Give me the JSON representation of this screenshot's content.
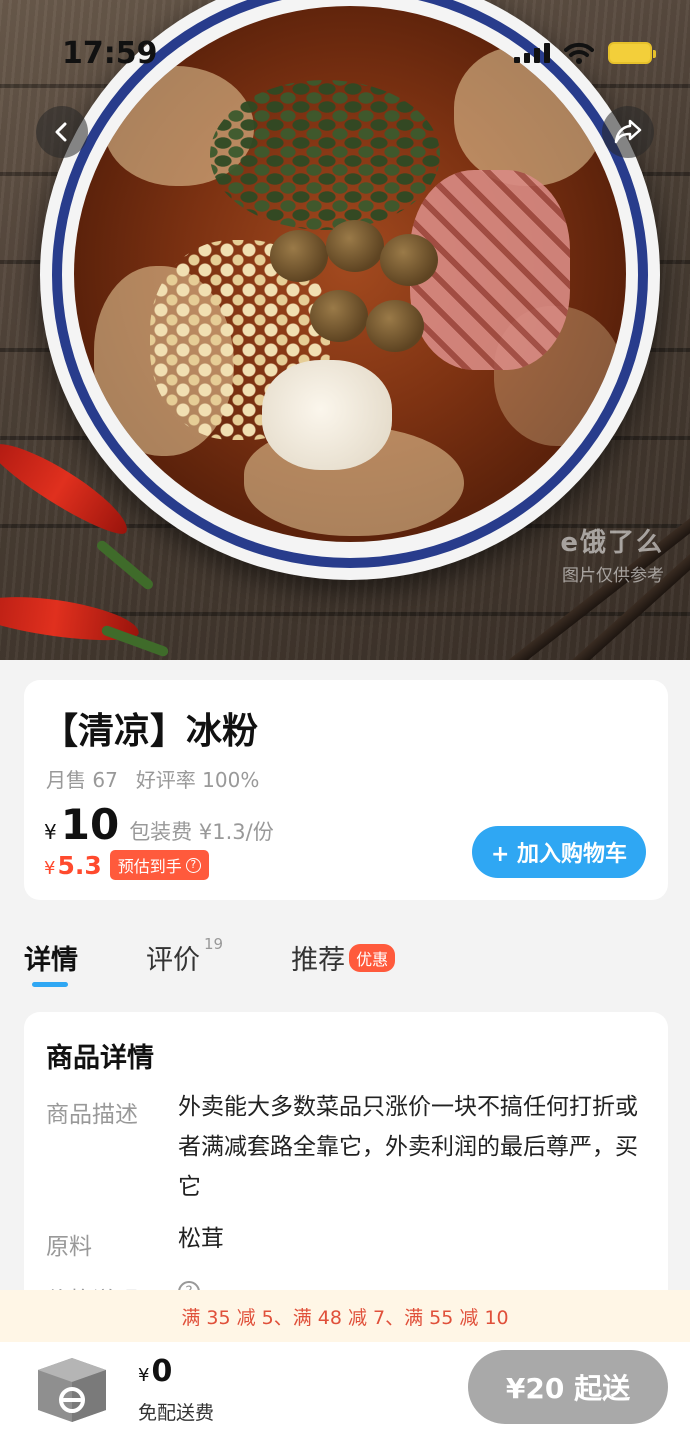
{
  "status_bar": {
    "time": "17:59"
  },
  "hero": {
    "watermark_logo": "e饿了么",
    "watermark_note": "图片仅供参考"
  },
  "icons": {
    "back": "chevron-left-icon",
    "share": "share-arrow-icon",
    "cart": "eleme-cart-box-icon",
    "help": "question-circle-icon"
  },
  "product": {
    "title": "【清凉】冰粉",
    "monthly_sales": "月售 67",
    "rating": "好评率 100%",
    "price_symbol": "¥",
    "price": "10",
    "packing_fee": "包装费 ¥1.3/份",
    "est_symbol": "¥",
    "est_price": "5.3",
    "est_badge": "预估到手",
    "add_to_cart": "+ 加入购物车"
  },
  "tabs": [
    {
      "label": "详情",
      "active": true
    },
    {
      "label": "评价",
      "count": "19"
    },
    {
      "label": "推荐",
      "badge": "优惠"
    }
  ],
  "details": {
    "heading": "商品详情",
    "rows": [
      {
        "label": "商品描述",
        "value": "外卖能大多数菜品只涨价一块不搞任何打折或者满减套路全靠它，外卖利润的最后尊严，买它"
      },
      {
        "label": "原料",
        "value": "松茸"
      },
      {
        "label": "价格说明",
        "value": ""
      }
    ]
  },
  "promo": {
    "text": "满 35 减 5、满 48 减 7、满 55 减 10"
  },
  "cart": {
    "symbol": "¥",
    "total": "0",
    "delivery": "免配送费",
    "min_order": "¥20 起送"
  },
  "colors": {
    "accent_blue": "#2fa7f3",
    "discount_red": "#ff4a2e",
    "promo_bg": "#fff6e6",
    "disabled_gray": "#a9a9a9"
  }
}
